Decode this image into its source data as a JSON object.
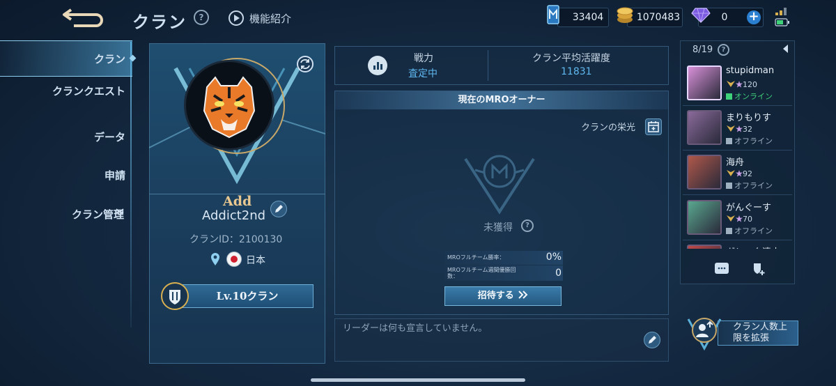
{
  "header": {
    "title": "クラン",
    "help_glyph": "?",
    "feature_intro": "機能紹介",
    "currencies": [
      {
        "icon": "mro-ticket-icon",
        "value": "33404"
      },
      {
        "icon": "gold-coin-icon",
        "value": "1070483"
      },
      {
        "icon": "diamond-icon",
        "value": "0"
      }
    ],
    "add_glyph": "+"
  },
  "nav": {
    "items": [
      {
        "label": "クラン",
        "active": true
      },
      {
        "label": "クランクエスト"
      },
      {
        "label": "データ"
      },
      {
        "label": "申請"
      },
      {
        "label": "クラン管理"
      }
    ]
  },
  "clan": {
    "tag": "Add",
    "name": "Addict2nd",
    "id_text": "クランID：2100130",
    "region": "日本",
    "level_label": "Lv.10クラン"
  },
  "stats": {
    "power_label": "戦力",
    "power_value": "査定中",
    "activity_label": "クラン平均活躍度",
    "activity_value": "11831"
  },
  "mro": {
    "header": "現在のMROオーナー",
    "glory_label": "クランの栄光",
    "status": "未獲得",
    "help_glyph": "?",
    "rows": [
      {
        "label": "MROフルチーム勝率：",
        "value": "0%"
      },
      {
        "label": "MROフルチーム週間優勝回数：",
        "value": "0"
      }
    ],
    "invite_label": "招待する"
  },
  "declaration": "リーダーは何も宣言していません。",
  "members": {
    "count": "8/19",
    "help_glyph": "?",
    "list": [
      {
        "name": "stupidman",
        "level": "120",
        "status": "オンライン",
        "online": true,
        "avatar_color": "#d890d8"
      },
      {
        "name": "まりもりす",
        "level": "32",
        "status": "オフライン",
        "online": false,
        "avatar_color": "#8a6a9a"
      },
      {
        "name": "海舟",
        "level": "92",
        "status": "オフライン",
        "online": false,
        "avatar_color": "#b0584a"
      },
      {
        "name": "がんぐーす",
        "level": "70",
        "status": "オフライン",
        "online": false,
        "avatar_color": "#5aa890"
      },
      {
        "name": "ガレッタ清水",
        "level": "",
        "status": "",
        "online": false,
        "avatar_color": "#c04848"
      }
    ]
  },
  "expand": {
    "label_line1": "クラン人数上",
    "label_line2": "限を拡張"
  },
  "colors": {
    "accent": "#5fb8f0",
    "online": "#3fd07a",
    "offline": "#9fb0c0",
    "gold": "#d8b050"
  }
}
